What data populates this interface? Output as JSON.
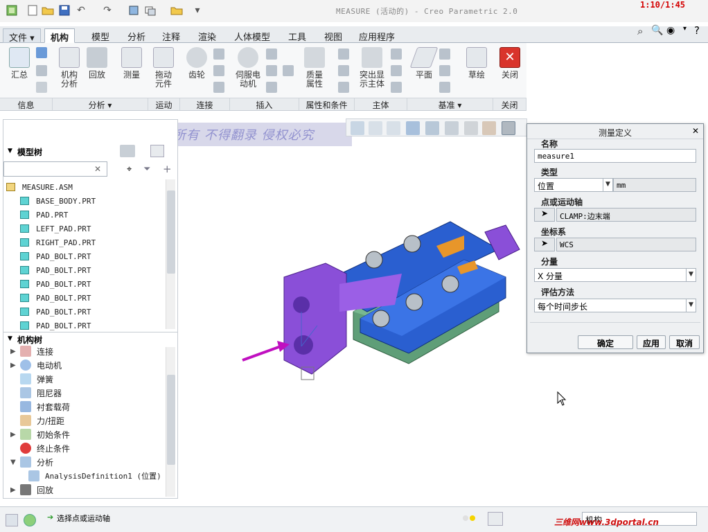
{
  "window": {
    "title": "MEASURE (活动的) - Creo Parametric 2.0",
    "timer": "1:10/1:45"
  },
  "tabs": [
    {
      "label": "文件",
      "dropdown": "▾"
    },
    {
      "label": "机构"
    },
    {
      "label": "模型"
    },
    {
      "label": "分析"
    },
    {
      "label": "注释"
    },
    {
      "label": "渲染"
    },
    {
      "label": "人体模型"
    },
    {
      "label": "工具"
    },
    {
      "label": "视图"
    },
    {
      "label": "应用程序"
    }
  ],
  "ribbon": {
    "buttons": [
      {
        "label": "汇总"
      },
      {
        "label": "机构\n分析"
      },
      {
        "label": "回放"
      },
      {
        "label": "测量"
      },
      {
        "label": "拖动\n元件"
      },
      {
        "label": "齿轮"
      },
      {
        "label": "伺服电\n动机"
      },
      {
        "label": "质量\n属性"
      },
      {
        "label": "突出显\n示主体"
      },
      {
        "label": "平面"
      },
      {
        "label": "草绘"
      },
      {
        "label": "关闭"
      }
    ],
    "groups": [
      {
        "label": "信息"
      },
      {
        "label": "分析 ▾"
      },
      {
        "label": "运动"
      },
      {
        "label": "连接"
      },
      {
        "label": "插入"
      },
      {
        "label": "属性和条件"
      },
      {
        "label": "主体"
      },
      {
        "label": "基准 ▾"
      },
      {
        "label": "关闭"
      }
    ]
  },
  "watermark": "版权所有  不得翻录  侵权必究",
  "model_tree": {
    "header": "模型树",
    "search_close": "✕",
    "root": "MEASURE.ASM",
    "items": [
      "BASE_BODY.PRT",
      "PAD.PRT",
      "LEFT_PAD.PRT",
      "RIGHT_PAD.PRT",
      "PAD_BOLT.PRT",
      "PAD_BOLT.PRT",
      "PAD_BOLT.PRT",
      "PAD_BOLT.PRT",
      "PAD_BOLT.PRT",
      "PAD_BOLT.PRT"
    ]
  },
  "mech_tree": {
    "header": "机构树",
    "items": [
      {
        "label": "连接",
        "icon_color": "#c04040"
      },
      {
        "label": "电动机",
        "icon_color": "#2f6fb8"
      },
      {
        "label": "弹簧",
        "icon_color": "#2f8fd0"
      },
      {
        "label": "阻尼器",
        "icon_color": "#3a7fbf"
      },
      {
        "label": "衬套载荷",
        "icon_color": "#3a70b0"
      },
      {
        "label": "力/扭距",
        "icon_color": "#c08030"
      },
      {
        "label": "初始条件",
        "icon_color": "#5a9a50"
      },
      {
        "label": "终止条件",
        "icon_color": "#d03030"
      },
      {
        "label": "分析",
        "icon_color": "#3a7fbf"
      },
      {
        "label": "AnalysisDefinition1 (位置)",
        "icon_color": "#3a7fbf"
      },
      {
        "label": "回放",
        "icon_color": "#555555"
      }
    ]
  },
  "dialog": {
    "title": "测量定义",
    "close": "✕",
    "name_label": "名称",
    "name_value": "measure1",
    "type_label": "类型",
    "type_value": "位置",
    "unit_value": "mm",
    "point_label": "点或运动轴",
    "point_value": "CLAMP:边末端",
    "csys_label": "坐标系",
    "csys_value": "WCS",
    "component_label": "分量",
    "component_value": "X 分量",
    "eval_label": "评估方法",
    "eval_value": "每个时间步长",
    "ok": "确定",
    "apply": "应用",
    "cancel": "取消"
  },
  "status": {
    "message": "选择点或运动轴",
    "filter": "机构",
    "brand": "三维网www.3dportal.cn"
  },
  "colors": {
    "model_blue": "#2a5fd0",
    "model_purple": "#8a4fd8",
    "model_green": "#5f9e78",
    "model_orange": "#e8962a",
    "arrow_magenta": "#c010c0"
  }
}
